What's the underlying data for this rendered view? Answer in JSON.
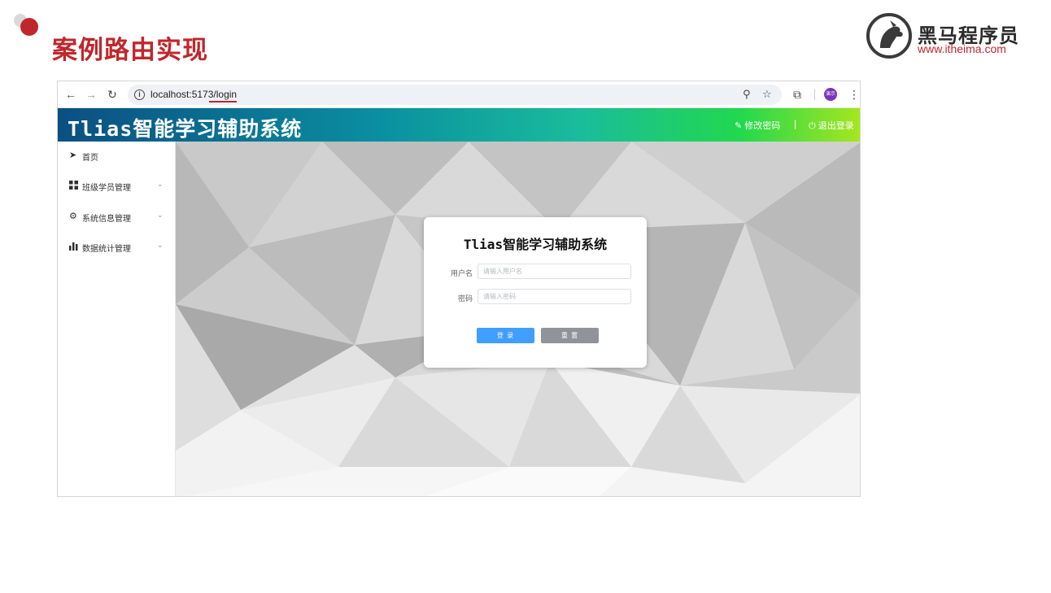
{
  "slide": {
    "title": "案例路由实现",
    "brand_name": "黑马程序员",
    "brand_url": "www.itheima.com",
    "accent_color": "#c0272d"
  },
  "browser": {
    "url": "localhost:5173/login",
    "avatar_text": "演示",
    "icons": [
      "back-arrow-icon",
      "forward-arrow-icon",
      "reload-icon",
      "info-icon",
      "zoom-icon",
      "star-icon",
      "extensions-icon",
      "more-icon"
    ]
  },
  "app": {
    "title": "Tlias智能学习辅助系统",
    "change_password": "修改密码",
    "separator": "|",
    "logout": "退出登录"
  },
  "sidebar": {
    "items": [
      {
        "label": "首页",
        "icon": "paper-plane-icon"
      },
      {
        "label": "班级学员管理",
        "icon": "grid-icon",
        "expandable": true
      },
      {
        "label": "系统信息管理",
        "icon": "gear-icon",
        "expandable": true
      },
      {
        "label": "数据统计管理",
        "icon": "bar-chart-icon",
        "expandable": true
      }
    ]
  },
  "login": {
    "title": "Tlias智能学习辅助系统",
    "username_label": "用户名",
    "username_placeholder": "请输入用户名",
    "password_label": "密码",
    "password_placeholder": "请输入密码",
    "login_button": "登 录",
    "reset_button": "重 置",
    "primary_color": "#409eff",
    "reset_color": "#909399"
  }
}
